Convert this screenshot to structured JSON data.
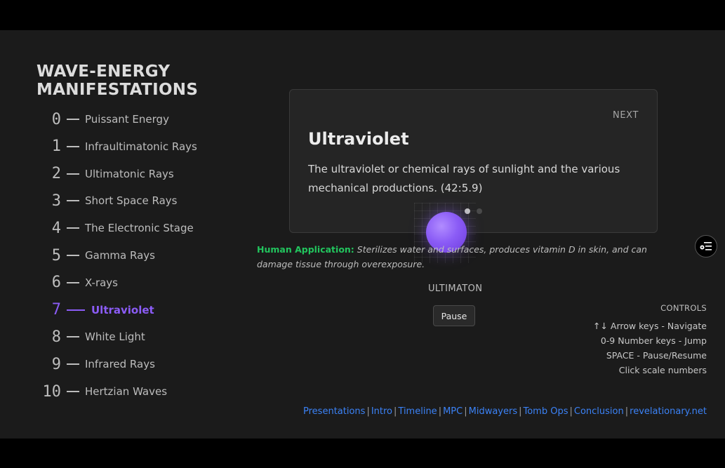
{
  "title_line1": "WAVE-ENERGY",
  "title_line2": "MANIFESTATIONS",
  "scale": [
    {
      "num": "0",
      "label": "Puissant Energy"
    },
    {
      "num": "1",
      "label": "Infraultimatonic Rays"
    },
    {
      "num": "2",
      "label": "Ultimatonic Rays"
    },
    {
      "num": "3",
      "label": "Short Space Rays"
    },
    {
      "num": "4",
      "label": "The Electronic Stage"
    },
    {
      "num": "5",
      "label": "Gamma Rays"
    },
    {
      "num": "6",
      "label": "X-rays"
    },
    {
      "num": "7",
      "label": "Ultraviolet"
    },
    {
      "num": "8",
      "label": "White Light"
    },
    {
      "num": "9",
      "label": "Infrared Rays"
    },
    {
      "num": "10",
      "label": "Hertzian Waves"
    }
  ],
  "active_index": 7,
  "card": {
    "next_label": "NEXT",
    "title": "Ultraviolet",
    "description": "The ultraviolet or chemical rays of sunlight and the various mechanical productions. (42:5.9)",
    "pagination_total": 2,
    "pagination_current": 1
  },
  "application": {
    "label": "Human Application:",
    "text": "Sterilizes water and surfaces, produces vitamin D in skin, and can damage tissue through overexposure."
  },
  "orb": {
    "name": "ULTIMATON",
    "color": "#8b5cf6"
  },
  "pause_label": "Pause",
  "controls": {
    "title": "CONTROLS",
    "lines": [
      "↑↓ Arrow keys - Navigate",
      "0-9 Number keys - Jump",
      "SPACE - Pause/Resume",
      "Click scale numbers"
    ]
  },
  "links": [
    "Presentations",
    "Intro",
    "Timeline",
    "MPC",
    "Midwayers",
    "Tomb Ops",
    "Conclusion",
    "revelationary.net"
  ],
  "colors": {
    "accent": "#8b5cf6",
    "application": "#22c55e",
    "link": "#3b82f6"
  },
  "icons": {
    "menu": "menu-settings-icon"
  }
}
